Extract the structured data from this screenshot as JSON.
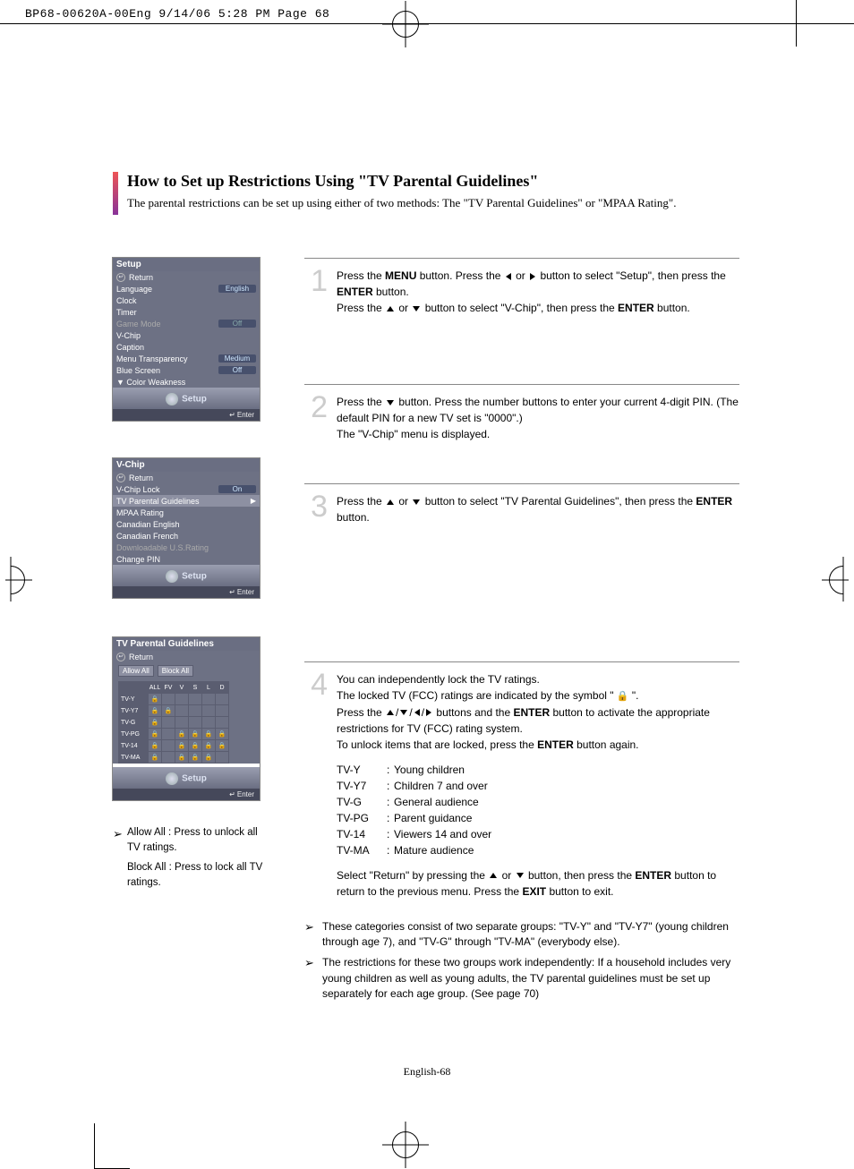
{
  "header_slug": "BP68-00620A-00Eng  9/14/06  5:28 PM  Page 68",
  "title": "How to Set up Restrictions Using \"TV Parental Guidelines\"",
  "subtitle": "The parental restrictions can be set up using either of two methods: The \"TV Parental Guidelines\" or \"MPAA Rating\".",
  "footer": "English-68",
  "osd1": {
    "title": "Setup",
    "return": "Return",
    "rows": [
      {
        "label": "Language",
        "val": "English"
      },
      {
        "label": "Clock"
      },
      {
        "label": "Timer"
      },
      {
        "label": "Game Mode",
        "val": "Off",
        "dim": true
      },
      {
        "label": "V-Chip"
      },
      {
        "label": "Caption"
      },
      {
        "label": "Menu Transparency",
        "val": "Medium"
      },
      {
        "label": "Blue Screen",
        "val": "Off"
      },
      {
        "label": "▼ Color Weakness"
      }
    ],
    "setup": "Setup",
    "enter": "Enter"
  },
  "osd2": {
    "title": "V-Chip",
    "return": "Return",
    "rows": [
      {
        "label": "V-Chip Lock",
        "val": "On"
      },
      {
        "label": "TV Parental Guidelines",
        "hl": true,
        "arrow": true
      },
      {
        "label": "MPAA Rating"
      },
      {
        "label": "Canadian English"
      },
      {
        "label": "Canadian French"
      },
      {
        "label": "Downloadable U.S.Rating",
        "dim": true
      },
      {
        "label": "Change PIN"
      }
    ],
    "setup": "Setup",
    "enter": "Enter"
  },
  "osd3": {
    "title": "TV Parental Guidelines",
    "return": "Return",
    "btns": [
      "Allow All",
      "Block All"
    ],
    "cols": [
      "ALL",
      "FV",
      "V",
      "S",
      "L",
      "D"
    ],
    "rows": [
      "TV-Y",
      "TV-Y7",
      "TV-G",
      "TV-PG",
      "TV-14",
      "TV-MA"
    ],
    "setup": "Setup",
    "enter": "Enter"
  },
  "left_notes": {
    "a": "Allow All : Press to unlock all TV ratings.",
    "b": "Block All : Press to lock all TV ratings."
  },
  "steps": {
    "s1a": "Press the ",
    "s1_menu": "MENU",
    "s1b": " button. Press the ",
    "s1c": " or ",
    "s1d": " button to select \"Setup\", then press  the ",
    "s1_enter": "ENTER",
    "s1e": " button.",
    "s1f": "Press the ",
    "s1g": " or ",
    "s1h": " button to select \"V-Chip\", then press the ",
    "s1i": " button.",
    "s2a": "Press the ",
    "s2b": " button. Press the number buttons to enter your current 4-digit PIN. (The default PIN for a new TV set is \"0000\".)",
    "s2c": "The \"V-Chip\" menu is displayed.",
    "s3a": "Press the ",
    "s3b": " or ",
    "s3c": " button to select \"TV Parental Guidelines\", then press the ",
    "s3d": " button.",
    "s4a": "You can independently lock the TV ratings.",
    "s4b": "The locked TV (FCC) ratings are indicated by the symbol \" ",
    "s4b2": " \".",
    "s4c": "Press the ",
    "s4d": " buttons and the ",
    "s4e": " button to activate the appropriate restrictions for TV (FCC) rating system.",
    "s4f": "To unlock items that are locked, press the ",
    "s4g": " button again.",
    "s4_sel_a": "Select \"Return\" by pressing the ",
    "s4_sel_b": " or ",
    "s4_sel_c": " button, then press the ",
    "s4_sel_d": " button to return to the previous menu. Press the ",
    "s4_exit": "EXIT",
    "s4_sel_e": " button to exit."
  },
  "ratings": [
    {
      "k": "TV-Y",
      "v": "Young children"
    },
    {
      "k": "TV-Y7",
      "v": "Children 7 and over"
    },
    {
      "k": "TV-G",
      "v": "General audience"
    },
    {
      "k": "TV-PG",
      "v": "Parent guidance"
    },
    {
      "k": "TV-14",
      "v": "Viewers 14 and over"
    },
    {
      "k": "TV-MA",
      "v": "Mature audience"
    }
  ],
  "notes": {
    "n1": "These categories consist of two separate groups: \"TV-Y\" and \"TV-Y7\" (young children through age 7), and \"TV-G\" through \"TV-MA\" (everybody else).",
    "n2": "The restrictions for these two groups work independently: If a household includes very young children as well as young adults, the TV parental guidelines must be set up separately for each age group. (See page 70)"
  }
}
